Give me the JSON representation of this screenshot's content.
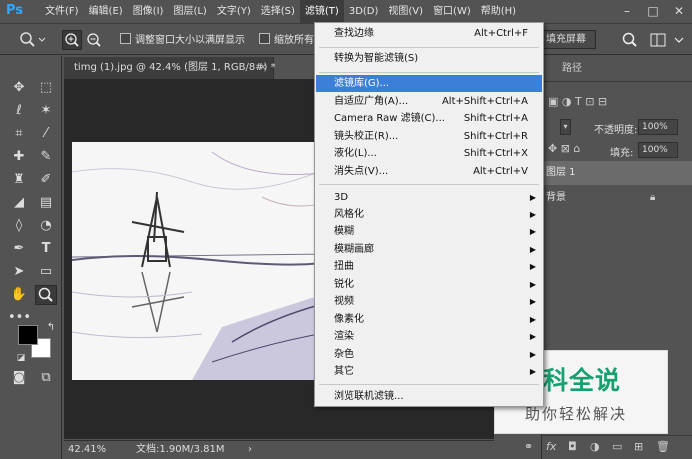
{
  "app": {
    "logo": "Ps"
  },
  "menubar": {
    "items": [
      "文件(F)",
      "编辑(E)",
      "图像(I)",
      "图层(L)",
      "文字(Y)",
      "选择(S)",
      "滤镜(T)",
      "3D(D)",
      "视图(V)",
      "窗口(W)",
      "帮助(H)"
    ],
    "active_index": 6,
    "win_minimize": "–",
    "win_maximize": "□",
    "win_close": "✕"
  },
  "options_bar": {
    "checkbox_resize_label": "调整窗口大小以满屏显示",
    "checkbox_zoom_all_label": "缩放所有",
    "fill_screen_label": "填充屏幕"
  },
  "document": {
    "tab_title": "timg (1).jpg @ 42.4% (图层 1, RGB/8#) *",
    "tab_close": "×",
    "zoom": "42.41%",
    "doc_info": "文档:1.90M/3.81M"
  },
  "filter_menu": {
    "items": [
      {
        "label": "查找边缘",
        "shortcut": "Alt+Ctrl+F"
      },
      {
        "label": "转换为智能滤镜(S)",
        "shortcut": ""
      },
      {
        "label": "滤镜库(G)...",
        "shortcut": ""
      },
      {
        "label": "自适应广角(A)...",
        "shortcut": "Alt+Shift+Ctrl+A"
      },
      {
        "label": "Camera Raw 滤镜(C)...",
        "shortcut": "Shift+Ctrl+A"
      },
      {
        "label": "镜头校正(R)...",
        "shortcut": "Shift+Ctrl+R"
      },
      {
        "label": "液化(L)...",
        "shortcut": "Shift+Ctrl+X"
      },
      {
        "label": "消失点(V)...",
        "shortcut": "Alt+Ctrl+V"
      },
      {
        "label": "3D",
        "shortcut": ""
      },
      {
        "label": "风格化",
        "shortcut": ""
      },
      {
        "label": "模糊",
        "shortcut": ""
      },
      {
        "label": "模糊画廊",
        "shortcut": ""
      },
      {
        "label": "扭曲",
        "shortcut": ""
      },
      {
        "label": "锐化",
        "shortcut": ""
      },
      {
        "label": "视频",
        "shortcut": ""
      },
      {
        "label": "像素化",
        "shortcut": ""
      },
      {
        "label": "渲染",
        "shortcut": ""
      },
      {
        "label": "杂色",
        "shortcut": ""
      },
      {
        "label": "其它",
        "shortcut": ""
      },
      {
        "label": "浏览联机滤镜...",
        "shortcut": ""
      }
    ],
    "highlighted_index": 2
  },
  "layers_panel": {
    "tab_paths": "路径",
    "opacity_label": "不透明度:",
    "opacity_value": "100%",
    "fill_label": "填充:",
    "fill_value": "100%",
    "layers": [
      {
        "name": "图层 1",
        "selected": true
      },
      {
        "name": "背景",
        "selected": false
      }
    ],
    "bottom_fx": "fx"
  },
  "watermark": {
    "title": "百科全说",
    "subtitle": "助你轻松解决"
  },
  "colors": {
    "ui_bg": "#535353",
    "canvas_bg": "#282828",
    "menu_highlight": "#3b7fd9",
    "watermark_green": "#17a06f"
  }
}
